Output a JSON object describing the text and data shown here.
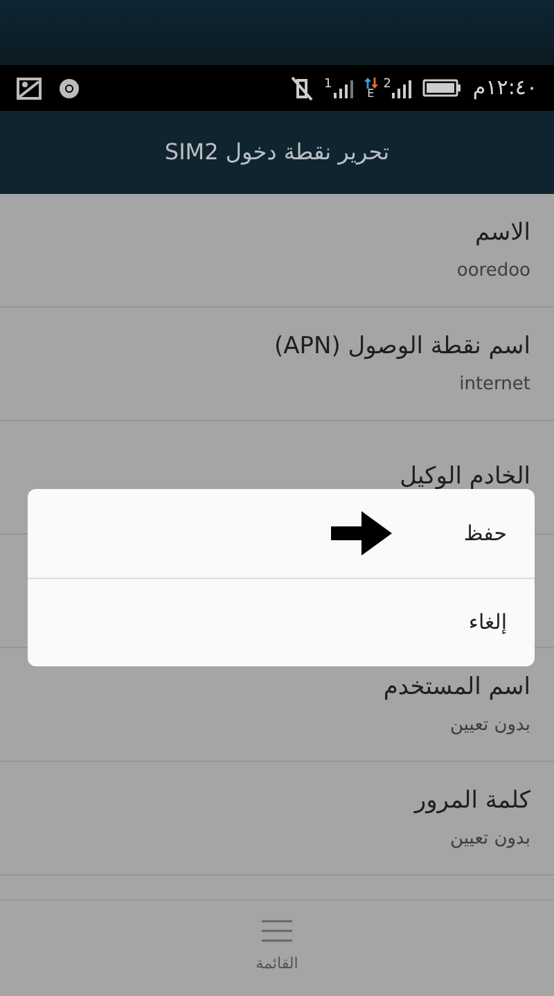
{
  "status_bar": {
    "time": "١٢:٤٠م",
    "sim1_label": "1",
    "sim2_label": "2",
    "network_type": "E"
  },
  "title": "تحرير نقطة دخول SIM2",
  "fields": [
    {
      "label": "الاسم",
      "value": "ooredoo"
    },
    {
      "label": "اسم نقطة الوصول (APN)",
      "value": "internet"
    },
    {
      "label": "الخادم الوكيل"
    },
    {
      "label": "اسم المستخدم",
      "value": "بدون تعيين"
    },
    {
      "label": "كلمة المرور",
      "value": "بدون تعيين"
    }
  ],
  "dialog": {
    "options": [
      {
        "label": "حفظ",
        "marked": true
      },
      {
        "label": "إلغاء",
        "marked": false
      }
    ]
  },
  "bottom_bar": {
    "label": "القائمة"
  }
}
